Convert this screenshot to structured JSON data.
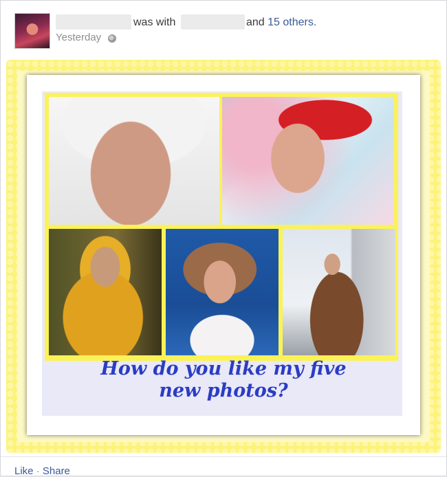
{
  "post": {
    "was_with": "was with",
    "and_text": "and",
    "others_link": "15 others.",
    "timestamp": "Yesterday",
    "privacy_icon": "globe-icon"
  },
  "photo": {
    "caption_line1": "How do you like my five",
    "caption_line2": "new photos?"
  },
  "actions": {
    "like": "Like",
    "separator": "·",
    "share": "Share"
  }
}
